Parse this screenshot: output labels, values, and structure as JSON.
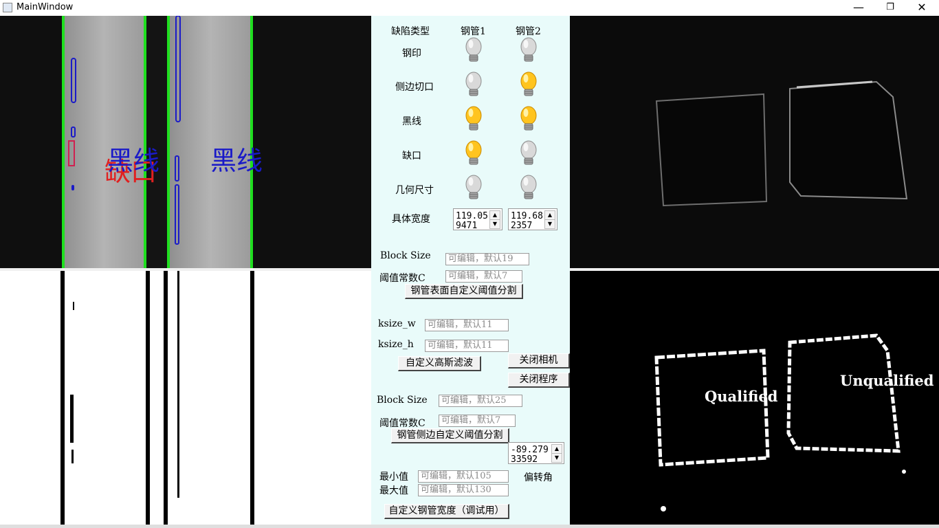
{
  "window": {
    "title": "MainWindow",
    "minimize": "—",
    "restore": "❐",
    "close": "✕"
  },
  "defects": {
    "header": {
      "type": "缺陷类型",
      "pipe1": "钢管1",
      "pipe2": "钢管2"
    },
    "rows": [
      {
        "label": "钢印",
        "pipe1_on": false,
        "pipe2_on": false
      },
      {
        "label": "侧边切口",
        "pipe1_on": false,
        "pipe2_on": true
      },
      {
        "label": "黑线",
        "pipe1_on": true,
        "pipe2_on": true
      },
      {
        "label": "缺口",
        "pipe1_on": true,
        "pipe2_on": false
      },
      {
        "label": "几何尺寸",
        "pipe1_on": false,
        "pipe2_on": false
      }
    ]
  },
  "width": {
    "label": "具体宽度",
    "pipe1": "119.059471",
    "pipe2": "119.682357"
  },
  "surface": {
    "block_label": "Block Size",
    "block_ph": "可编辑，默认19",
    "c_label": "阈值常数C",
    "c_ph": "可编辑，默认7",
    "btn": "钢管表面自定义阈值分割"
  },
  "gauss": {
    "w_label": "ksize_w",
    "w_ph": "可编辑，默认11",
    "h_label": "ksize_h",
    "h_ph": "可编辑，默认11",
    "btn": "自定义高斯滤波"
  },
  "close_camera": "关闭相机",
  "close_program": "关闭程序",
  "side": {
    "block_label": "Block Size",
    "block_ph": "可编辑，默认25",
    "c_label": "阈值常数C",
    "c_ph": "可编辑，默认7",
    "btn": "钢管侧边自定义阈值分割"
  },
  "rotation": {
    "value": "-89.27933592",
    "label": "偏转角"
  },
  "range": {
    "min_label": "最小值",
    "min_ph": "可编辑，默认105",
    "max_label": "最大值",
    "max_ph": "可编辑，默认130"
  },
  "width_btn": "自定义钢管宽度（调试用）",
  "overlay": {
    "blackline": "黑线",
    "notch": "缺口",
    "qualified": "Qualified",
    "unqualified": "Unqualified"
  },
  "colors": {
    "panel_bg": "#e9fbfa",
    "edge_green": "#1fe01f",
    "mark_blue": "#1a1ac8",
    "mark_red": "#e02020"
  }
}
